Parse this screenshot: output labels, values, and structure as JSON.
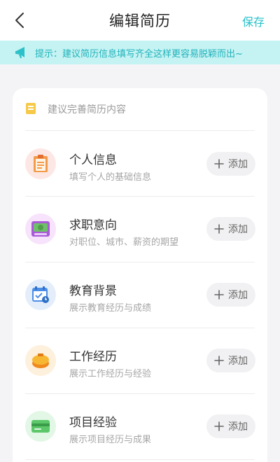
{
  "nav": {
    "title": "编辑简历",
    "save_label": "保存"
  },
  "tip": {
    "text": "提示：建议简历信息填写齐全这样更容易脱颖而出~",
    "color": "#1fb3bc",
    "background": "#c5f2f2"
  },
  "card": {
    "hint": "建议完善简历内容",
    "items": [
      {
        "icon": "clipboard-icon",
        "title": "个人信息",
        "desc": "填写个人的基础信息",
        "add_label": "添加"
      },
      {
        "icon": "money-icon",
        "title": "求职意向",
        "desc": "对职位、城市、薪资的期望",
        "add_label": "添加"
      },
      {
        "icon": "calendar-icon",
        "title": "教育背景",
        "desc": "展示教育经历与成绩",
        "add_label": "添加"
      },
      {
        "icon": "briefcase-icon",
        "title": "工作经历",
        "desc": "展示工作经历与经验",
        "add_label": "添加"
      },
      {
        "icon": "card-icon",
        "title": "项目经验",
        "desc": "展示项目经历与成果",
        "add_label": "添加"
      }
    ]
  }
}
